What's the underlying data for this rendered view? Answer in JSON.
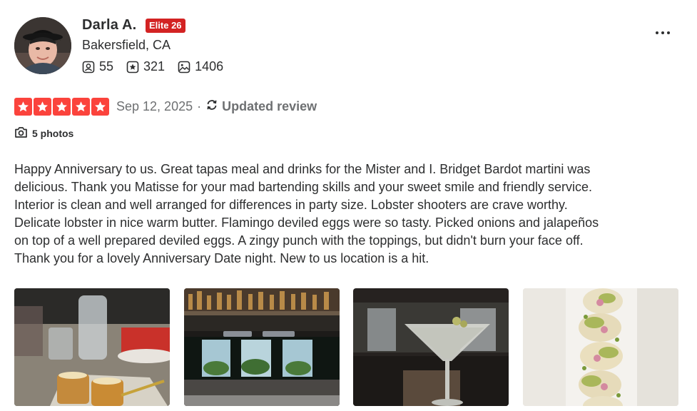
{
  "user": {
    "name": "Darla A.",
    "elite_badge": "Elite 26",
    "location": "Bakersfield, CA",
    "stats": {
      "friends": "55",
      "reviews": "321",
      "photos": "1406"
    }
  },
  "review": {
    "rating": 5,
    "date": "Sep 12, 2025",
    "separator": "·",
    "updated_label": "Updated review",
    "photos_label": "5 photos",
    "text": "Happy Anniversary to us. Great tapas meal and drinks for the Mister and I. Bridget Bardot martini was delicious. Thank you Matisse for your mad bartending skills and your sweet smile and friendly service. Interior is clean and well arranged for differences in party size. Lobster shooters are crave worthy. Delicate lobster in nice warm butter. Flamingo deviled eggs were so tasty. Picked onions and jalapeños on top of a well prepared deviled eggs. A zingy punch with the toppings, but didn't burn your face off. Thank you for a lovely Anniversary Date night. New to us location is a hit."
  },
  "icons": {
    "friends": "friends-icon",
    "reviews": "review-star-icon",
    "photos": "photo-icon",
    "camera": "camera-icon",
    "updated": "refresh-icon",
    "menu": "more-horizontal-icon"
  },
  "colors": {
    "star_red": "#fb433c",
    "elite_red": "#d32323",
    "text": "#2d2e2f",
    "muted": "#6e7072"
  }
}
